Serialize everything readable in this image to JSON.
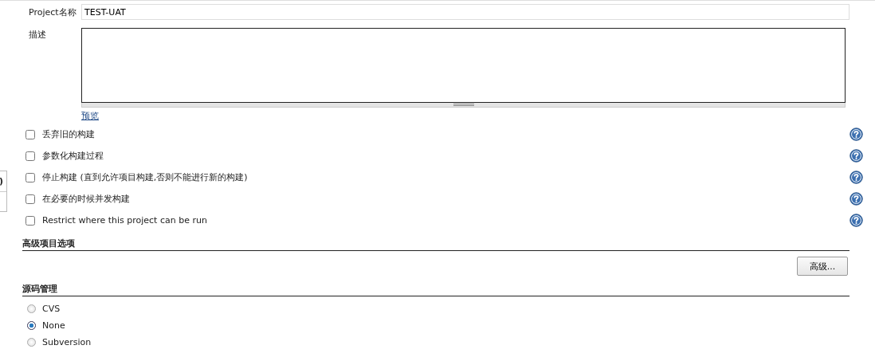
{
  "sidebar_fragment": {
    "items": [
      ")"
    ]
  },
  "project": {
    "name_label": "Project名称",
    "name_value": "TEST-UAT",
    "description_label": "描述",
    "preview_link": "预览"
  },
  "options": [
    {
      "label": "丢弃旧的构建",
      "checked": false
    },
    {
      "label": "参数化构建过程",
      "checked": false
    },
    {
      "label": "停止构建 (直到允许项目构建,否则不能进行新的构建)",
      "checked": false
    },
    {
      "label": "在必要的时候并发构建",
      "checked": false
    },
    {
      "label": "Restrict where this project can be run",
      "checked": false
    }
  ],
  "advanced_section": {
    "title": "高级项目选项",
    "button": "高级..."
  },
  "scm_section": {
    "title": "源码管理",
    "options": [
      {
        "label": "CVS",
        "selected": false
      },
      {
        "label": "None",
        "selected": true
      },
      {
        "label": "Subversion",
        "selected": false
      }
    ]
  }
}
